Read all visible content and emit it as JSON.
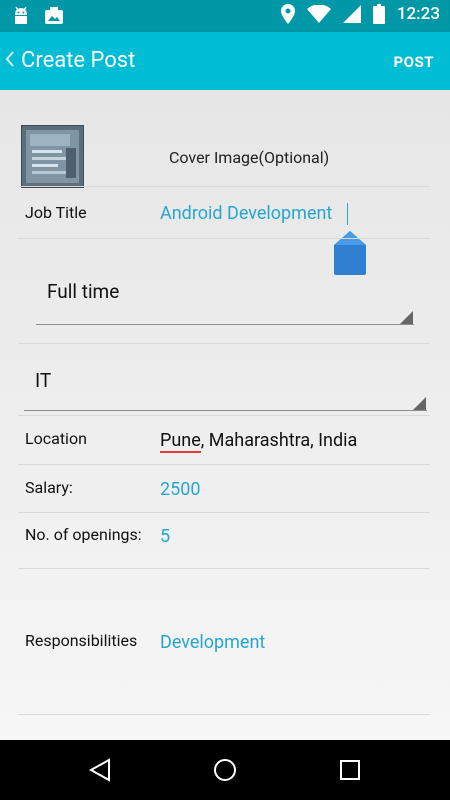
{
  "status_bar": {
    "time": "12:23",
    "icons": [
      "android-icon",
      "photo-icon",
      "location-icon",
      "wifi-icon",
      "signal-icon",
      "battery-icon"
    ]
  },
  "action_bar": {
    "title": "Create Post",
    "action_label": "POST"
  },
  "form": {
    "cover_image_label": "Cover Image(Optional)",
    "job_title_label": "Job Title",
    "job_title_value": "Android Development",
    "job_type_selected": "Full time",
    "category_selected": "IT",
    "location_label": "Location",
    "location_value_city": "Pune",
    "location_value_rest": ", Maharashtra, India",
    "salary_label": "Salary:",
    "salary_value": "2500",
    "openings_label": "No. of openings:",
    "openings_value": "5",
    "responsibilities_label": "Responsibilities",
    "responsibilities_value": "Development"
  },
  "colors": {
    "status_bar": "#0097a7",
    "action_bar": "#00bcd4",
    "value_text": "#26a6d1"
  }
}
